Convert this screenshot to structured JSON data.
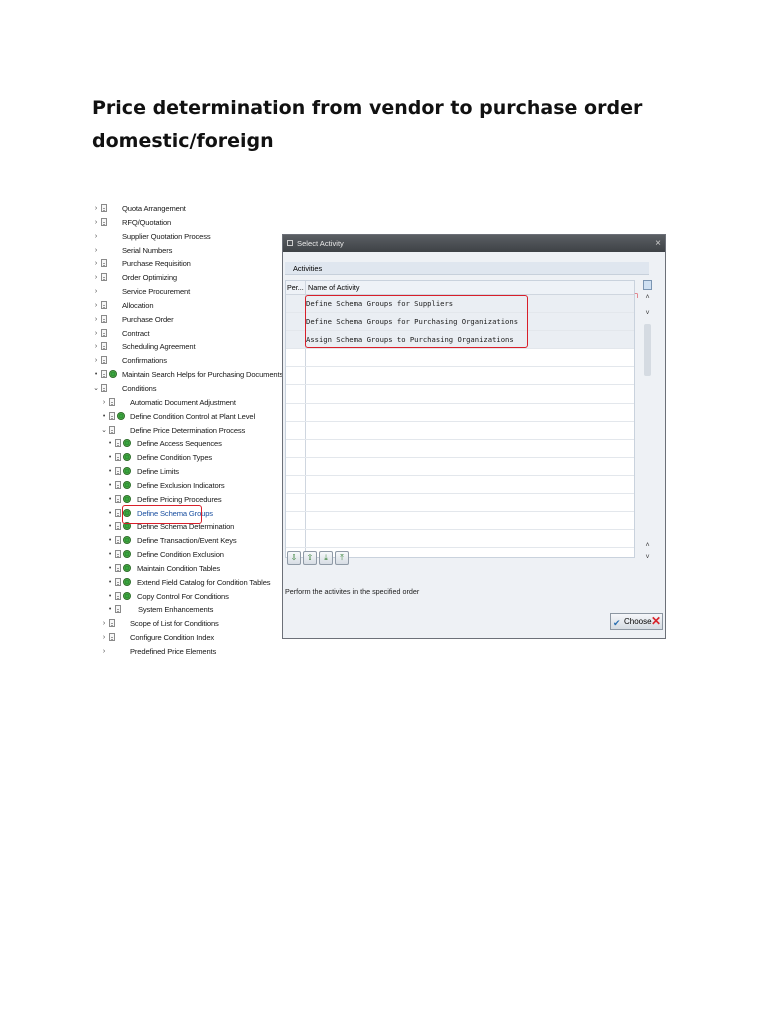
{
  "document": {
    "title_line1": "Price determination from vendor to purchase order",
    "title_line2": "domestic/foreign"
  },
  "tree": {
    "items": [
      {
        "label": "Quota Arrangement",
        "indent": 0,
        "toggle": "›",
        "doc": true,
        "gear": false
      },
      {
        "label": "RFQ/Quotation",
        "indent": 0,
        "toggle": "›",
        "doc": true,
        "gear": false
      },
      {
        "label": "Supplier Quotation Process",
        "indent": 0,
        "toggle": "›",
        "doc": false,
        "gear": false
      },
      {
        "label": "Serial Numbers",
        "indent": 0,
        "toggle": "›",
        "doc": false,
        "gear": false
      },
      {
        "label": "Purchase Requisition",
        "indent": 0,
        "toggle": "›",
        "doc": true,
        "gear": false
      },
      {
        "label": "Order Optimizing",
        "indent": 0,
        "toggle": "›",
        "doc": true,
        "gear": false
      },
      {
        "label": "Service Procurement",
        "indent": 0,
        "toggle": "›",
        "doc": false,
        "gear": false
      },
      {
        "label": "Allocation",
        "indent": 0,
        "toggle": "›",
        "doc": true,
        "gear": false
      },
      {
        "label": "Purchase Order",
        "indent": 0,
        "toggle": "›",
        "doc": true,
        "gear": false
      },
      {
        "label": "Contract",
        "indent": 0,
        "toggle": "›",
        "doc": true,
        "gear": false
      },
      {
        "label": "Scheduling Agreement",
        "indent": 0,
        "toggle": "›",
        "doc": true,
        "gear": false
      },
      {
        "label": "Confirmations",
        "indent": 0,
        "toggle": "›",
        "doc": true,
        "gear": false
      },
      {
        "label": "Maintain Search Helps for Purchasing Documents",
        "indent": 0,
        "toggle": "•",
        "doc": true,
        "gear": true
      },
      {
        "label": "Conditions",
        "indent": 0,
        "toggle": "⌄",
        "doc": true,
        "gear": false
      },
      {
        "label": "Automatic Document Adjustment",
        "indent": 1,
        "toggle": "›",
        "doc": true,
        "gear": false
      },
      {
        "label": "Define Condition Control at Plant Level",
        "indent": 1,
        "toggle": "•",
        "doc": true,
        "gear": true
      },
      {
        "label": "Define Price Determination Process",
        "indent": 1,
        "toggle": "⌄",
        "doc": true,
        "gear": false
      },
      {
        "label": "Define Access Sequences",
        "indent": 2,
        "toggle": "•",
        "doc": true,
        "gear": true
      },
      {
        "label": "Define Condition Types",
        "indent": 2,
        "toggle": "•",
        "doc": true,
        "gear": true
      },
      {
        "label": "Define Limits",
        "indent": 2,
        "toggle": "•",
        "doc": true,
        "gear": true
      },
      {
        "label": "Define Exclusion Indicators",
        "indent": 2,
        "toggle": "•",
        "doc": true,
        "gear": true
      },
      {
        "label": "Define Pricing Procedures",
        "indent": 2,
        "toggle": "•",
        "doc": true,
        "gear": true
      },
      {
        "label": "Define Schema Groups",
        "indent": 2,
        "toggle": "•",
        "doc": true,
        "gear": true,
        "link": true
      },
      {
        "label": "Define Schema Determination",
        "indent": 2,
        "toggle": "•",
        "doc": true,
        "gear": true
      },
      {
        "label": "Define Transaction/Event Keys",
        "indent": 2,
        "toggle": "•",
        "doc": true,
        "gear": true
      },
      {
        "label": "Define Condition Exclusion",
        "indent": 2,
        "toggle": "•",
        "doc": true,
        "gear": true
      },
      {
        "label": "Maintain Condition Tables",
        "indent": 2,
        "toggle": "•",
        "doc": true,
        "gear": true
      },
      {
        "label": "Extend Field Catalog for Condition Tables",
        "indent": 2,
        "toggle": "•",
        "doc": true,
        "gear": true
      },
      {
        "label": "Copy Control For Conditions",
        "indent": 2,
        "toggle": "•",
        "doc": true,
        "gear": true
      },
      {
        "label": "System Enhancements",
        "indent": 2,
        "toggle": "•",
        "doc": true,
        "gear": false
      },
      {
        "label": "Scope of List for Conditions",
        "indent": 1,
        "toggle": "›",
        "doc": true,
        "gear": false
      },
      {
        "label": "Configure Condition Index",
        "indent": 1,
        "toggle": "›",
        "doc": true,
        "gear": false
      },
      {
        "label": "Predefined Price Elements",
        "indent": 1,
        "toggle": "›",
        "doc": false,
        "gear": false
      }
    ]
  },
  "dialog": {
    "title": "Select Activity",
    "panel_label": "Activities",
    "columns": {
      "col1": "Per...",
      "col2": "Name of Activity"
    },
    "rows": [
      "Define Schema Groups for Suppliers",
      "Define Schema Groups for Purchasing Organizations",
      "Assign Schema Groups to Purchasing Organizations",
      "",
      "",
      "",
      "",
      "",
      "",
      "",
      "",
      "",
      "",
      "",
      ""
    ],
    "toolbar_icons": [
      "select-all-icon",
      "deselect-icon",
      "move-down-icon",
      "move-up-icon"
    ],
    "hint": "Perform the activites in the specified order",
    "choose_label": "Choose"
  },
  "colors": {
    "highlight": "#d81f2a",
    "link": "#1a4fa0"
  }
}
